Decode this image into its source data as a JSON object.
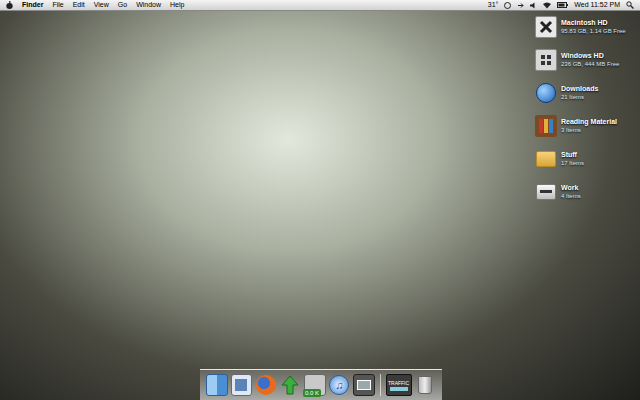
{
  "menubar": {
    "app": "Finder",
    "menus": [
      "File",
      "Edit",
      "View",
      "Go",
      "Window",
      "Help"
    ],
    "temperature": "31°",
    "clock": "Wed 11:52 PM"
  },
  "desktop_icons": [
    {
      "name": "Macintosh HD",
      "info": "95.83 GB, 1.14 GB Free",
      "kind": "drive-mac"
    },
    {
      "name": "Windows HD",
      "info": "236 GB, 444 MB Free",
      "kind": "drive-windows"
    },
    {
      "name": "Downloads",
      "info": "21 Items",
      "kind": "globe"
    },
    {
      "name": "Reading Material",
      "info": "3 Items",
      "kind": "books"
    },
    {
      "name": "Stuff",
      "info": "17 Items",
      "kind": "folder"
    },
    {
      "name": "Work",
      "info": "4 Items",
      "kind": "printer"
    }
  ],
  "dock": {
    "items": [
      {
        "kind": "finder",
        "label": ""
      },
      {
        "kind": "preview",
        "label": ""
      },
      {
        "kind": "firefox",
        "label": ""
      },
      {
        "kind": "arrow",
        "label": ""
      },
      {
        "kind": "meter",
        "label": "0.0 K"
      },
      {
        "kind": "itunes",
        "label": ""
      },
      {
        "kind": "screen",
        "label": ""
      },
      {
        "kind": "separator",
        "label": ""
      },
      {
        "kind": "traffic",
        "label": "TRAFFIC"
      },
      {
        "kind": "trash",
        "label": ""
      }
    ]
  }
}
